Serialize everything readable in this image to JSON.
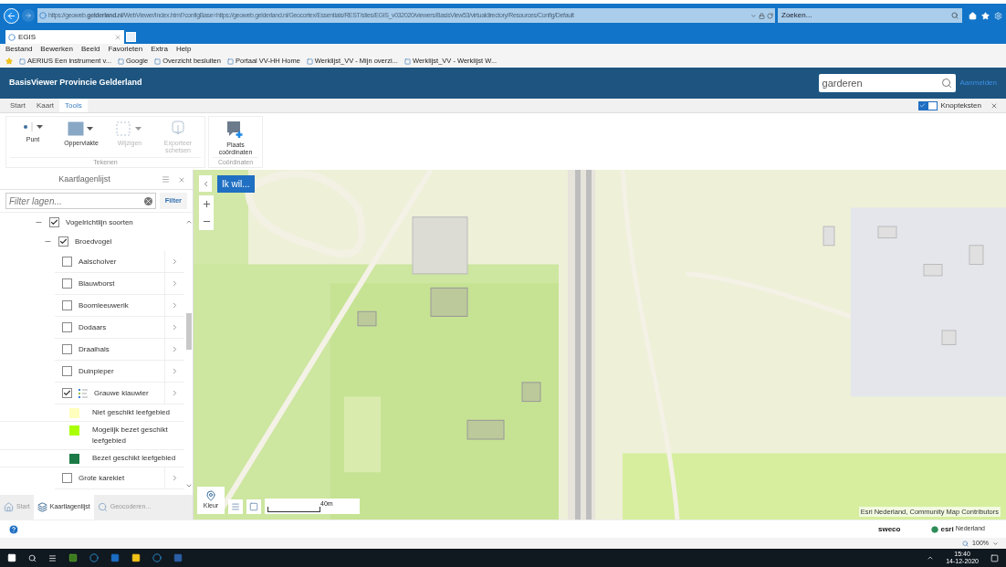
{
  "browser": {
    "url_domain": "https://geoweb.**gelderland.nl**/WebViewer/Index.html?configBase=https://geoweb.gelderland.nl/Geocortex/Essentials/REST/sites/EGIS_v032020/viewers/BasisView53/virtualdirectory/Resources/Config/Default",
    "search_placeholder": "Zoeken...",
    "tab_title": "EGIS",
    "menu": [
      "Bestand",
      "Bewerken",
      "Beeld",
      "Favorieten",
      "Extra",
      "Help"
    ],
    "favorites": [
      "AERIUS Een instrument v...",
      "Google",
      "Overzicht besluiten",
      "Portaal VV-HH Home",
      "Werklijst_VV - Mijn overzi...",
      "Werklijst_VV - Werklijst W..."
    ],
    "zoom": "100%"
  },
  "app": {
    "title": "BasisViewer Provincie Gelderland",
    "search_value": "garderen",
    "login": "Aanmelden"
  },
  "ribbon": {
    "tabs": [
      {
        "label": "Start",
        "selected": false
      },
      {
        "label": "Kaart",
        "selected": false
      },
      {
        "label": "Tools",
        "selected": true
      }
    ],
    "toggle": {
      "label": "Knopteksten",
      "checked": true
    },
    "groups": [
      {
        "label": "Tekenen",
        "tools": [
          {
            "label": "Punt",
            "disabled": false,
            "kind": "point"
          },
          {
            "label": "Oppervlakte",
            "disabled": false,
            "kind": "area"
          },
          {
            "label": "Wijzigen",
            "disabled": true,
            "kind": "edit"
          },
          {
            "label": "Exporteer schetsen",
            "disabled": true,
            "kind": "export"
          }
        ]
      },
      {
        "label": "Coördinaten",
        "tools": [
          {
            "label": "Plaats coördinaten",
            "disabled": false,
            "kind": "coords"
          }
        ]
      }
    ]
  },
  "layers_panel": {
    "title": "Kaartlagenlijst",
    "filter_placeholder": "Filter lagen...",
    "filter_button": "Filter",
    "tree": [
      {
        "label": "Vogelrichtlijn soorten",
        "kind": "group",
        "checked": true,
        "expanded": true,
        "children": [
          {
            "label": "Broedvogel",
            "kind": "group",
            "checked": true,
            "expanded": true,
            "children": [
              {
                "label": "Aalscholver",
                "kind": "layer",
                "checked": false
              },
              {
                "label": "Blauwborst",
                "kind": "layer",
                "checked": false
              },
              {
                "label": "Boomleeuwerik",
                "kind": "layer",
                "checked": false
              },
              {
                "label": "Dodaars",
                "kind": "layer",
                "checked": false
              },
              {
                "label": "Draaihals",
                "kind": "layer",
                "checked": false
              },
              {
                "label": "Duinpieper",
                "kind": "layer",
                "checked": false
              },
              {
                "label": "Grauwe klauwier",
                "kind": "layer",
                "checked": true,
                "children": [
                  {
                    "label": "Niet geschikt leefgebied",
                    "kind": "legend",
                    "color": "#ffffbe"
                  },
                  {
                    "label": "Mogelijk bezet geschikt leefgebied",
                    "kind": "legend",
                    "color": "#aaff00"
                  },
                  {
                    "label": "Bezet geschikt leefgebied",
                    "kind": "legend",
                    "color": "#1b7a45"
                  }
                ]
              },
              {
                "label": "Grote karekiet",
                "kind": "layer",
                "checked": false
              }
            ]
          }
        ]
      }
    ],
    "bottom_tabs": [
      {
        "label": "Start",
        "selected": false
      },
      {
        "label": "Kaartlagenlijst",
        "selected": true
      },
      {
        "label": "Geocoderen...",
        "selected": false
      }
    ]
  },
  "map": {
    "action_button": "Ik wil...",
    "color_tool": "Kleur",
    "scale": "40m",
    "attribution": "Esri Nederland, Community Map Contributors"
  },
  "footer": {
    "sweco": "sweco",
    "esri": "esri",
    "esri_sub": "Nederland"
  },
  "taskbar": {
    "time": "15:40",
    "date": "14-12-2020"
  }
}
